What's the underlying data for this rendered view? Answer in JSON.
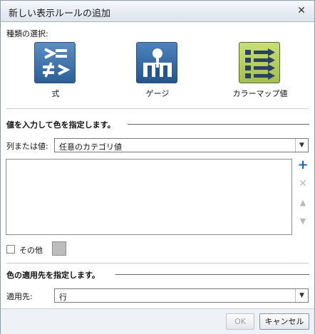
{
  "dialog": {
    "title": "新しい表示ルールの追加",
    "close_symbol": "✕"
  },
  "type_select": {
    "label": "種類の選択:",
    "options": [
      {
        "label": "式",
        "icon": "formula-icon"
      },
      {
        "label": "ゲージ",
        "icon": "gauge-icon"
      },
      {
        "label": "カラーマップ値",
        "icon": "color-map-icon"
      }
    ]
  },
  "value_section": {
    "heading": "値を入力して色を指定します。",
    "column_label": "列または値:",
    "column_value": "任意のカテゴリ値",
    "add_symbol": "+",
    "remove_symbol": "✕",
    "up_symbol": "▲",
    "down_symbol": "▼",
    "other_label": "その他",
    "other_color": "#bdbdbd"
  },
  "apply_section": {
    "heading": "色の適用先を指定します。",
    "target_label": "適用先:",
    "target_value": "行"
  },
  "footer": {
    "ok_label": "OK",
    "cancel_label": "キャンセル"
  },
  "colors": {
    "accent": "#1f5fa8",
    "colormap_icon": "#b8d564",
    "formula_icon": "#3f74ae"
  }
}
